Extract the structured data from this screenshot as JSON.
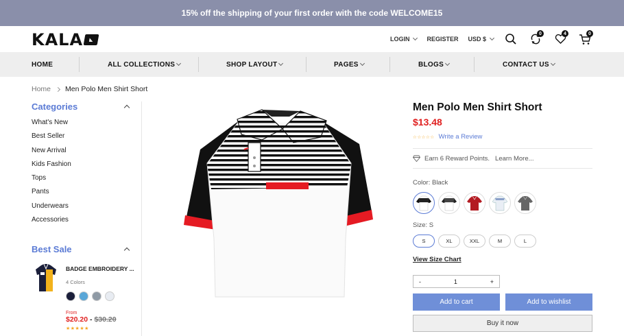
{
  "promo": {
    "text": "15% off the shipping of your first order with the code WELCOME15"
  },
  "header": {
    "logo": "KALA",
    "login": "LOGIN",
    "register": "REGISTER",
    "currency": "USD $",
    "compare_count": "0",
    "wishlist_count": "4",
    "cart_count": "0",
    "icons": [
      "search-icon",
      "compare-icon",
      "heart-icon",
      "cart-icon"
    ]
  },
  "nav": {
    "items": [
      {
        "label": "HOME"
      },
      {
        "label": "ALL COLLECTIONS"
      },
      {
        "label": "SHOP LAYOUT"
      },
      {
        "label": "PAGES"
      },
      {
        "label": "BLOGS"
      },
      {
        "label": "CONTACT US"
      }
    ]
  },
  "breadcrumb": {
    "home": "Home",
    "current": "Men Polo Men Shirt Short"
  },
  "sidebar": {
    "categories_title": "Categories",
    "categories": [
      "What's New",
      "Best Seller",
      "New Arrival",
      "Kids Fashion",
      "Tops",
      "Pants",
      "Underwears",
      "Accessories"
    ],
    "best_sale_title": "Best Sale",
    "best_sale_item": {
      "name": "BADGE EMBROIDERY ...",
      "colors_label": "4 Colors",
      "from_label": "From",
      "price": "$20.20",
      "dash": "-",
      "old_price": "$30.20",
      "stars": "★★★★★",
      "swatch_colors": [
        "#1b1f3a",
        "#5aa7d8",
        "#8f9aa5",
        "#e8ecf2"
      ]
    }
  },
  "product": {
    "title": "Men Polo Men Shirt Short",
    "price": "$13.48",
    "stars": "☆☆☆☆☆",
    "write_review": "Write a Review",
    "reward_text": "Earn 6 Reward Points.",
    "learn_more": "Learn More...",
    "color_label": "Color: Black",
    "color_swatches": [
      "#222222",
      "#444444",
      "#b31b22",
      "#e9eef5",
      "#666666"
    ],
    "size_label": "Size: S",
    "sizes": [
      "S",
      "XL",
      "XXL",
      "M",
      "L"
    ],
    "size_chart": "View Size Chart",
    "qty_minus": "-",
    "qty_value": "1",
    "qty_plus": "+",
    "add_to_cart": "Add to cart",
    "add_to_wishlist": "Add to wishlist",
    "buy_now": "Buy it now"
  },
  "colors": {
    "accent": "#5b7bd5",
    "price": "#e02020",
    "promo_bg": "#8a8faa",
    "nav_bg": "#eeeeee",
    "button": "#6f8fd8"
  }
}
